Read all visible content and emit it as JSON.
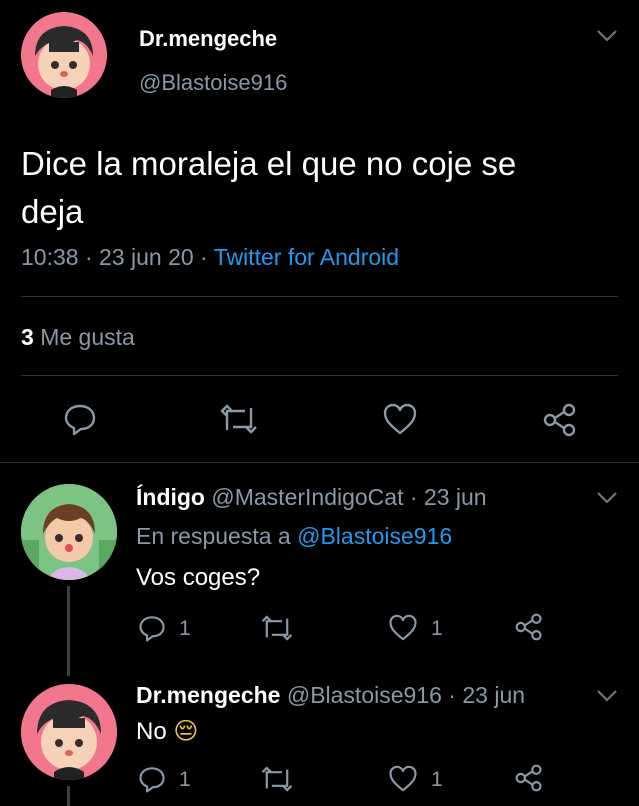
{
  "main_tweet": {
    "display_name": "Dr.mengeche",
    "handle": "@Blastoise916",
    "text_line1": "Dice la moraleja el que no coje se",
    "text_line2": "deja",
    "time": "10:38",
    "dot1": "·",
    "date": "23 jun 20",
    "dot2": "·",
    "source": "Twitter for Android",
    "likes_count": "3",
    "likes_label": "Me gusta"
  },
  "reply1": {
    "display_name": "Índigo",
    "handle": "@MasterIndigoCat",
    "dot": "·",
    "date": "23 jun",
    "reply_prefix": "En respuesta a",
    "reply_to": "@Blastoise916",
    "text": "Vos coges?",
    "reply_count": "1",
    "like_count": "1"
  },
  "reply2": {
    "display_name": "Dr.mengeche",
    "handle": "@Blastoise916",
    "dot": "·",
    "date": "23 jun",
    "text": "No",
    "emoji": "😔",
    "reply_count": "1",
    "like_count": "1"
  },
  "colors": {
    "background": "#000000",
    "muted": "#8b98a5",
    "link": "#1d9bf0",
    "divider": "#2f3336"
  }
}
